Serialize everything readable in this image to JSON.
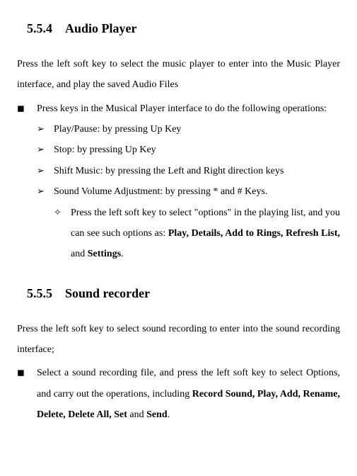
{
  "section1": {
    "num": "5.5.4",
    "title": "Audio Player",
    "intro": "Press the left soft key to select the music player to enter into the Music Player interface, and play the saved Audio Files",
    "bullet1": "Press keys in the Musical Player interface to do the following operations:",
    "sub1": "Play/Pause: by pressing Up Key",
    "sub2": "Stop: by pressing Up Key",
    "sub3": "Shift Music: by pressing the Left and Right direction keys",
    "sub4": "Sound Volume Adjustment: by pressing * and # Keys.",
    "sub4a_pre": "Press the left soft key to select \"options\" in the playing list, and you can see such options as: ",
    "sub4a_bold": "Play, Details, Add to Rings, Refresh List, ",
    "sub4a_mid": "and ",
    "sub4a_bold2": "Settings",
    "sub4a_end": "."
  },
  "section2": {
    "num": "5.5.5",
    "title": "Sound recorder",
    "intro": "Press the left soft key to select sound recording to enter into the sound recording interface;",
    "bullet1_pre": "Select a sound recording file, and press the left soft key to select Options, and carry out the operations, including ",
    "bullet1_bold1": "Record Sound, Play, Add, Rename, Delete, Delete All, Set ",
    "bullet1_mid": "and ",
    "bullet1_bold2": "Send",
    "bullet1_end": "."
  }
}
